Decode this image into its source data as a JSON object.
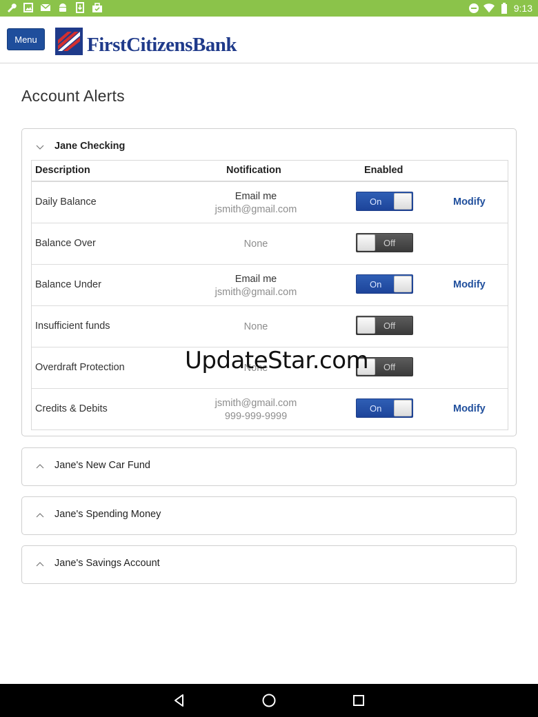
{
  "status_bar": {
    "time": "9:13",
    "left_icons": [
      "wrench-icon",
      "image-icon",
      "gmail-icon",
      "android-icon",
      "download-icon",
      "briefcase-icon"
    ],
    "right_icons": [
      "do-not-disturb-icon",
      "wifi-icon",
      "battery-icon"
    ]
  },
  "header": {
    "menu_label": "Menu",
    "bank_name": "FirstCitizensBank",
    "brand_color": "#1f3a8a"
  },
  "page": {
    "title": "Account Alerts"
  },
  "main_panel": {
    "title": "Jane Checking",
    "expanded": true,
    "columns": [
      "Description",
      "Notification",
      "Enabled"
    ],
    "rows": [
      {
        "description": "Daily Balance",
        "notif_line1": "Email me",
        "notif_line2": "jsmith@gmail.com",
        "enabled": true,
        "toggle_label": "On",
        "action": "Modify"
      },
      {
        "description": "Balance Over",
        "notif_line1": "None",
        "notif_line2": "",
        "enabled": false,
        "toggle_label": "Off",
        "action": ""
      },
      {
        "description": "Balance Under",
        "notif_line1": "Email me",
        "notif_line2": "jsmith@gmail.com",
        "enabled": true,
        "toggle_label": "On",
        "action": "Modify"
      },
      {
        "description": "Insufficient funds",
        "notif_line1": "None",
        "notif_line2": "",
        "enabled": false,
        "toggle_label": "Off",
        "action": ""
      },
      {
        "description": "Overdraft Protection",
        "notif_line1": "None",
        "notif_line2": "",
        "enabled": false,
        "toggle_label": "Off",
        "action": ""
      },
      {
        "description": "Credits & Debits",
        "notif_line1": "jsmith@gmail.com",
        "notif_line2": "999-999-9999",
        "enabled": true,
        "toggle_label": "On",
        "action": "Modify"
      }
    ]
  },
  "collapsed_panels": [
    {
      "title": "Jane's New Car Fund"
    },
    {
      "title": "Jane's Spending Money"
    },
    {
      "title": "Jane's Savings Account"
    }
  ],
  "watermark": "UpdateStar.com",
  "navbar": {
    "icons": [
      "back-icon",
      "home-icon",
      "recents-icon"
    ]
  },
  "colors": {
    "status_bar": "#8bc34a",
    "accent": "#1f4e9c",
    "toggle_on": "#2a56ab",
    "toggle_off": "#4a4a4a"
  }
}
